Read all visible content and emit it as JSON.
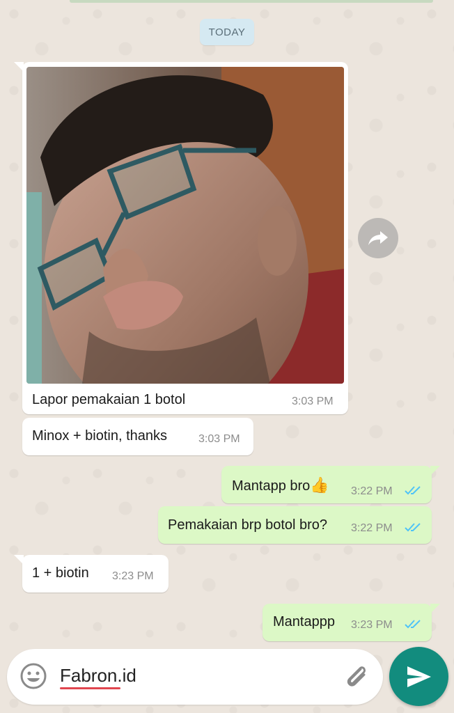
{
  "chat": {
    "date_label": "TODAY",
    "messages": [
      {
        "direction": "incoming",
        "type": "image",
        "caption": "Lapor pemakaian 1 botol",
        "time": "3:03 PM"
      },
      {
        "direction": "incoming",
        "type": "text",
        "text": "Minox + biotin, thanks",
        "time": "3:03 PM"
      },
      {
        "direction": "outgoing",
        "type": "text",
        "text": "Mantapp bro",
        "emoji": "👍",
        "time": "3:22 PM",
        "status": "read"
      },
      {
        "direction": "outgoing",
        "type": "text",
        "text": "Pemakaian brp botol bro?",
        "time": "3:22 PM",
        "status": "read"
      },
      {
        "direction": "incoming",
        "type": "text",
        "text": "1 + biotin",
        "time": "3:23 PM"
      },
      {
        "direction": "outgoing",
        "type": "text",
        "text": "Mantappp",
        "time": "3:23 PM",
        "status": "read"
      }
    ]
  },
  "composer": {
    "text": "Fabron.id",
    "icons": {
      "emoji": "emoji-icon",
      "attach": "paperclip-icon",
      "send": "send-icon"
    }
  },
  "colors": {
    "incoming_bubble": "#ffffff",
    "outgoing_bubble": "#dcf8c6",
    "read_ticks": "#4fc3f7",
    "send_button": "#128c7e",
    "date_chip": "#d5e9f2"
  }
}
